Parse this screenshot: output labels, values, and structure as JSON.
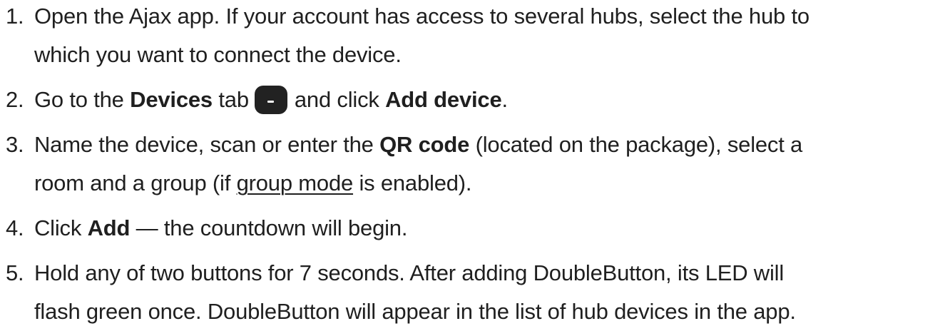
{
  "steps": [
    {
      "number": "1.",
      "lines": [
        "Open the Ajax app. If your account has access to several hubs, select the hub to",
        "which you want to connect the device."
      ]
    },
    {
      "number": "2.",
      "t1": "Go to the ",
      "b1": "Devices",
      "t2": " tab",
      "icon": "devices-tab-icon",
      "t3": "and click ",
      "b2": "Add device",
      "t4": "."
    },
    {
      "number": "3.",
      "t1": "Name the device, scan or enter the ",
      "b1": "QR code",
      "t2": " (located on the package), select a",
      "t3": "room and a group (if ",
      "link": "group mode",
      "t4": " is enabled)."
    },
    {
      "number": "4.",
      "t1": "Click ",
      "b1": "Add",
      "t2": " — the countdown will begin."
    },
    {
      "number": "5.",
      "lines": [
        "Hold any of two buttons for 7 seconds. After adding DoubleButton, its LED will",
        "flash green once. DoubleButton will appear in the list of hub devices in the app."
      ]
    }
  ]
}
